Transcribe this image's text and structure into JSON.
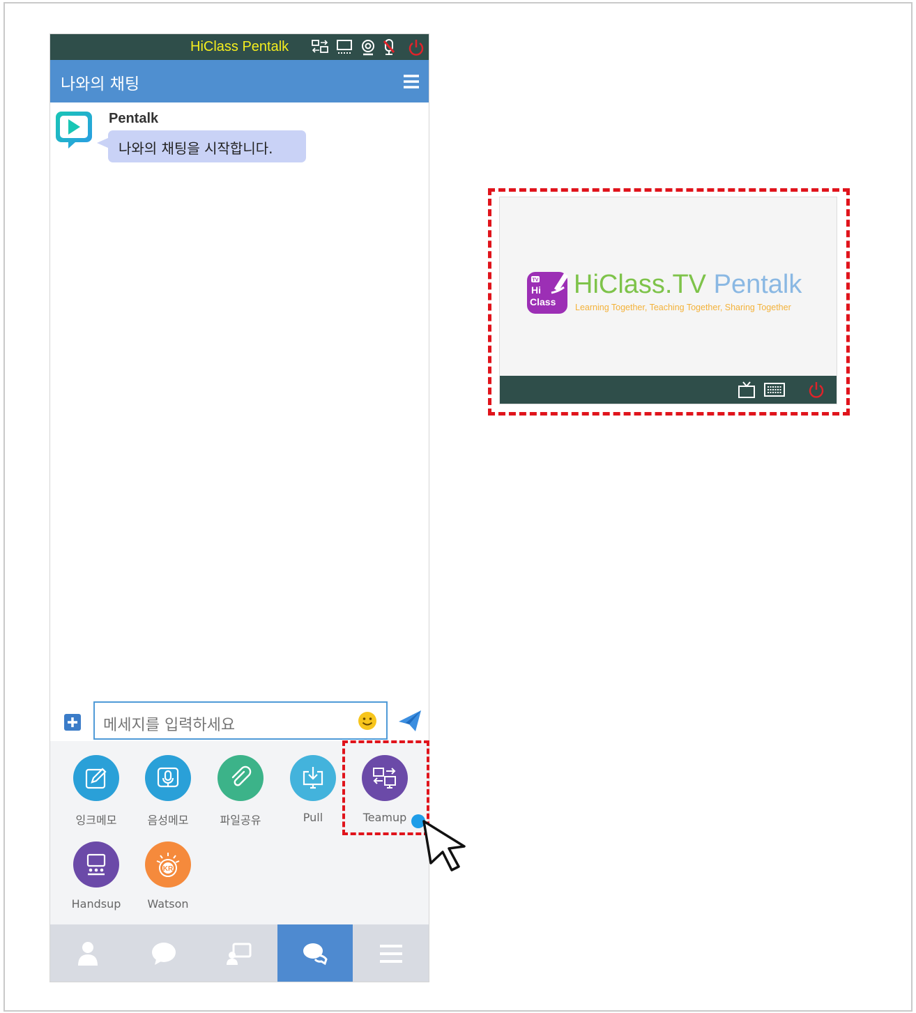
{
  "status_bar": {
    "app_name": "HiClass Pentalk"
  },
  "header": {
    "title": "나와의 채팅"
  },
  "chat": {
    "sender": "Pentalk",
    "message": "나와의 채팅을 시작합니다."
  },
  "composer": {
    "placeholder": "메세지를 입력하세요"
  },
  "tools": [
    {
      "label": "잉크메모",
      "icon": "pencil-icon",
      "color": "#2aa0d8"
    },
    {
      "label": "음성메모",
      "icon": "microphone-icon",
      "color": "#2aa0d8"
    },
    {
      "label": "파일공유",
      "icon": "paperclip-icon",
      "color": "#3cb389"
    },
    {
      "label": "Pull",
      "icon": "download-monitor-icon",
      "color": "#43b3dc"
    },
    {
      "label": "Teamup",
      "icon": "teamup-monitors-icon",
      "color": "#6b4aa8"
    },
    {
      "label": "Handsup",
      "icon": "presentation-icon",
      "color": "#6b4aa8"
    },
    {
      "label": "Watson",
      "icon": "watson-kr-icon",
      "color": "#f58a3c"
    }
  ],
  "bottom_nav": [
    {
      "icon": "person-icon",
      "active": false
    },
    {
      "icon": "speech-bubble-icon",
      "active": false
    },
    {
      "icon": "screen-share-icon",
      "active": false
    },
    {
      "icon": "chat-bubbles-icon",
      "active": true
    },
    {
      "icon": "hamburger-icon",
      "active": false
    }
  ],
  "preview": {
    "logo_badge_text": "TV Hi Class",
    "title_part1": "HiClass.TV",
    "title_part2": "Pentalk",
    "tagline": "Learning Together, Teaching Together, Sharing Together"
  },
  "colors": {
    "status_bar": "#2f4e4a",
    "header": "#4f8fd0",
    "highlight": "#e0141c",
    "app_name": "#f5ee1e"
  }
}
